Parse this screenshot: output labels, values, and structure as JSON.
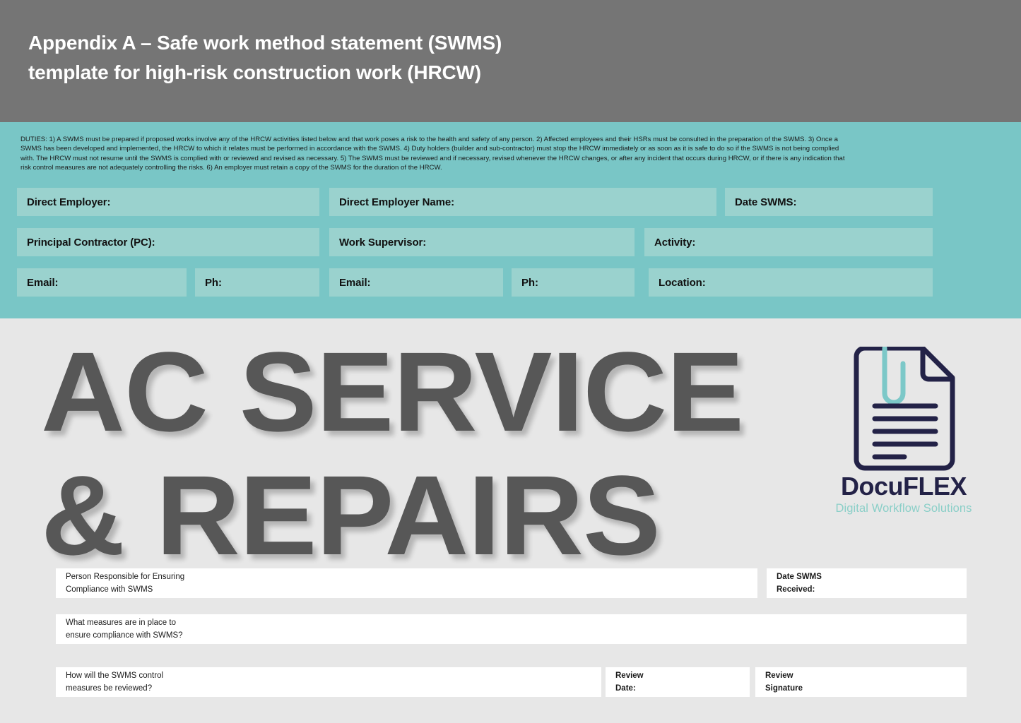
{
  "header": {
    "title": "Appendix A – Safe work method statement (SWMS)\ntemplate for high-risk construction work (HRCW)",
    "background_color": "#757575"
  },
  "duties": {
    "text": "DUTIES: 1) A SWMS must be prepared if proposed works involve any of the HRCW activities listed below and that work poses a risk to the health and safety of any person. 2) Affected employees and their HSRs must be consulted in the preparation of the SWMS. 3) Once a SWMS has been developed and implemented, the HRCW to which it relates must be performed in accordance with the SWMS. 4) Duty holders (builder and sub-contractor) must stop the HRCW immediately or as soon as it is safe to do so if the SWMS is not being complied with. The HRCW must not resume until the SWMS is complied with or reviewed and revised as necessary. 5) The SWMS must be reviewed and if necessary, revised whenever the HRCW changes, or after any incident that occurs during HRCW, or if there is any indication that risk control measures are not adequately controlling the risks. 6) An employer must retain a copy of the SWMS for the duration of the HRCW."
  },
  "teal_section": {
    "background_color": "#79c6c6",
    "field_color": "#9ad2ce",
    "fields": [
      {
        "label": "Direct Employer:",
        "value": ""
      },
      {
        "label": "Direct Employer Name:",
        "value": ""
      },
      {
        "label": "Date SWMS:",
        "value": ""
      },
      {
        "label": "Principal Contractor (PC):",
        "value": ""
      },
      {
        "label": "Work Supervisor:",
        "value": ""
      },
      {
        "label": "Activity:",
        "value": ""
      },
      {
        "label": "Email:",
        "value": ""
      },
      {
        "label": "Ph:",
        "value": ""
      },
      {
        "label": "Email:",
        "value": ""
      },
      {
        "label": "Ph:",
        "value": ""
      },
      {
        "label": "Location:",
        "value": ""
      }
    ]
  },
  "watermark": {
    "text": "AC SERVICE\n& REPAIRS",
    "color": "#575757"
  },
  "logo": {
    "name": "DocuFLEX",
    "tagline": "Digital Workflow Solutions",
    "navy": "#232247",
    "teal": "#8bcfc8"
  },
  "bottom_section": {
    "background_color": "#e7e7e7",
    "fields": [
      {
        "label": "Person Responsible for Ensuring\nCompliance with SWMS",
        "value": "",
        "bold": false
      },
      {
        "label": "Date SWMS\nReceived:",
        "value": "",
        "bold": true
      },
      {
        "label": "What measures are in place to\nensure compliance with SWMS?",
        "value": "",
        "bold": false
      },
      {
        "label": "How will the SWMS control\nmeasures be reviewed?",
        "value": "",
        "bold": false
      },
      {
        "label": "Review\nDate:",
        "value": "",
        "bold": true
      },
      {
        "label": "Review\nSignature",
        "value": "",
        "bold": true
      }
    ]
  }
}
